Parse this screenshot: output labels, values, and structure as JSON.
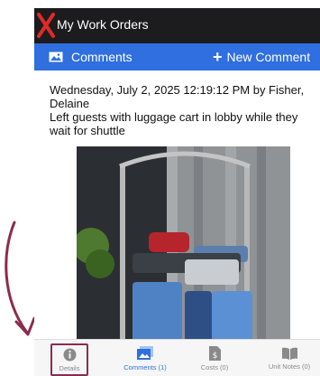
{
  "header": {
    "title": "My Work Orders"
  },
  "actions": {
    "comments_label": "Comments",
    "new_comment_label": "New Comment"
  },
  "comment": {
    "header": "Wednesday, July 2, 2025 12:19:12 PM by Fisher, Delaine",
    "text": "Left guests with luggage cart in lobby while they wait for shuttle"
  },
  "tabs": [
    {
      "label": "Details",
      "icon": "info-icon"
    },
    {
      "label": "Comments (1)",
      "icon": "image-icon"
    },
    {
      "label": "Costs (0)",
      "icon": "dollar-file-icon"
    },
    {
      "label": "Unit Notes (0)",
      "icon": "book-icon"
    }
  ],
  "colors": {
    "topbar": "#1c1c1e",
    "accent": "#2f6fdf",
    "annotation": "#8b2c4f"
  }
}
